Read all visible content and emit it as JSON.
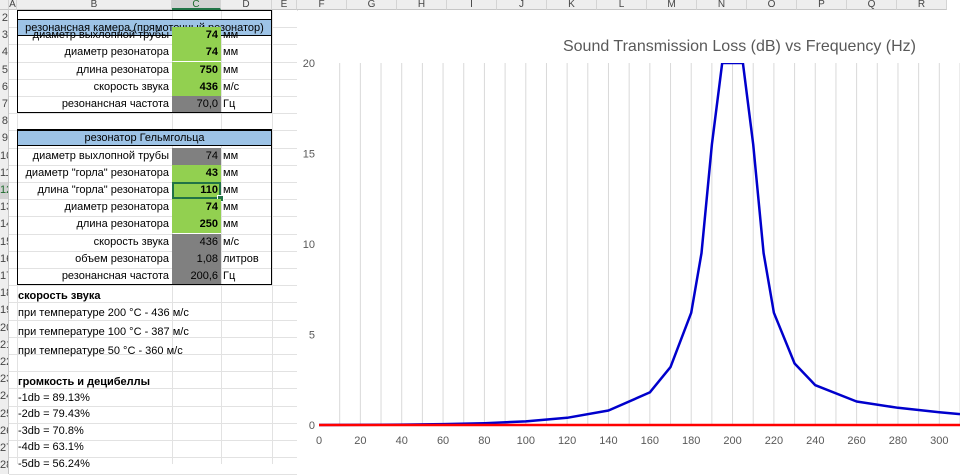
{
  "columns": [
    "A",
    "B",
    "C",
    "D",
    "E",
    "F",
    "G",
    "H",
    "I",
    "J",
    "K",
    "L",
    "M",
    "N",
    "O",
    "P",
    "Q",
    "R"
  ],
  "selected_column": "C",
  "rows": [
    "2",
    "3",
    "4",
    "5",
    "6",
    "7",
    "8",
    "9",
    "10",
    "11",
    "12",
    "13",
    "14",
    "15",
    "16",
    "17",
    "18",
    "19",
    "20",
    "21",
    "22",
    "23",
    "24",
    "25",
    "26",
    "27",
    "28"
  ],
  "selected_row": "12",
  "section1": {
    "title": "резонансная камера (прямоточный резонатор)",
    "items": [
      {
        "label": "диаметр выхлопной трубы",
        "value": "74",
        "unit": "мм",
        "style": "green"
      },
      {
        "label": "диаметр резонатора",
        "value": "74",
        "unit": "мм",
        "style": "green"
      },
      {
        "label": "длина резонатора",
        "value": "750",
        "unit": "мм",
        "style": "green"
      },
      {
        "label": "скорость звука",
        "value": "436",
        "unit": "м/с",
        "style": "green"
      },
      {
        "label": "резонансная частота",
        "value": "70,0",
        "unit": "Гц",
        "style": "gray"
      }
    ]
  },
  "section2": {
    "title": "резонатор Гельмгольца",
    "items": [
      {
        "label": "диаметр выхлопной трубы",
        "value": "74",
        "unit": "мм",
        "style": "gray"
      },
      {
        "label": "диаметр \"горла\" резонатора",
        "value": "43",
        "unit": "мм",
        "style": "green"
      },
      {
        "label": "длина \"горла\" резонатора",
        "value": "110",
        "unit": "мм",
        "style": "green"
      },
      {
        "label": "диаметр резонатора",
        "value": "74",
        "unit": "мм",
        "style": "green"
      },
      {
        "label": "длина резонатора",
        "value": "250",
        "unit": "мм",
        "style": "green"
      },
      {
        "label": "скорость звука",
        "value": "436",
        "unit": "м/с",
        "style": "gray"
      },
      {
        "label": "объем резонатора",
        "value": "1,08",
        "unit": "литров",
        "style": "gray"
      },
      {
        "label": "резонансная частота",
        "value": "200,6",
        "unit": "Гц",
        "style": "gray"
      }
    ]
  },
  "notes": {
    "speed_title": "скорость звука",
    "speed_lines": [
      "при температуре 200 °С - 436 м/с",
      "при температуре 100 °С - 387 м/с",
      "при температуре 50 °С - 360 м/с"
    ],
    "db_title": "громкость и децибеллы",
    "db_lines": [
      "-1db = 89.13%",
      "-2db = 79.43%",
      "-3db = 70.8%",
      "-4db = 63.1%",
      "-5db = 56.24%"
    ]
  },
  "chart_data": {
    "type": "line",
    "title": "Sound Transmission Loss (dB) vs Frequency (Hz)",
    "xlim": [
      0,
      310
    ],
    "ylim": [
      0,
      20
    ],
    "x_ticks": [
      0,
      20,
      40,
      60,
      80,
      100,
      120,
      140,
      160,
      180,
      200,
      220,
      240,
      260,
      280,
      300
    ],
    "y_ticks": [
      0,
      5,
      10,
      15,
      20
    ],
    "grid": "vertical",
    "series": [
      {
        "color": "#0000cc",
        "x": [
          0,
          40,
          60,
          80,
          100,
          120,
          140,
          160,
          170,
          180,
          185,
          190,
          195,
          197,
          200,
          203,
          205,
          210,
          215,
          220,
          230,
          240,
          260,
          280,
          300,
          310
        ],
        "y": [
          0,
          0.02,
          0.05,
          0.1,
          0.2,
          0.4,
          0.8,
          1.8,
          3.2,
          6.2,
          9.5,
          15.5,
          20,
          20,
          20,
          20,
          20,
          15.5,
          9.5,
          6.2,
          3.4,
          2.2,
          1.3,
          0.95,
          0.7,
          0.6
        ]
      },
      {
        "color": "#ff0000",
        "x": [
          0,
          310
        ],
        "y": [
          0,
          0
        ]
      }
    ]
  }
}
